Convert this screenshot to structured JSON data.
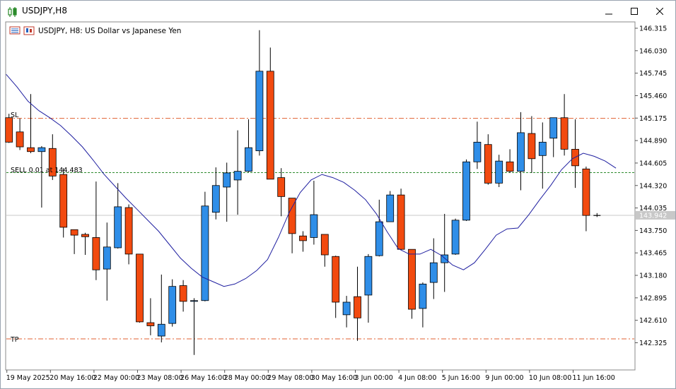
{
  "window": {
    "title": "USDJPY,H8",
    "controls": [
      "minimize",
      "maximize",
      "close"
    ]
  },
  "chart_header": "USDJPY, H8:  US Dollar vs Japanese Yen",
  "labels": {
    "sl": "SL",
    "tp": "TP",
    "order": "SELL 0.01 at 144.483",
    "current_price": "143.942"
  },
  "colors": {
    "bull": "#2f8ee8",
    "bear": "#f24a0f",
    "ma": "#1f1fa0",
    "sl_tp_line": "#e06030",
    "order_line": "#2e8b2e"
  },
  "chart_data": {
    "type": "candlestick",
    "symbol": "USDJPY",
    "timeframe": "H8",
    "ylim": [
      142.09,
      146.38
    ],
    "y_ticks": [
      "146.315",
      "146.030",
      "145.745",
      "145.460",
      "145.175",
      "144.890",
      "144.605",
      "144.320",
      "144.035",
      "143.750",
      "143.465",
      "143.180",
      "142.895",
      "142.610",
      "142.325"
    ],
    "x_labels": [
      "19 May 2025",
      "20 May 16:00",
      "22 May 00:00",
      "23 May 08:00",
      "26 May 16:00",
      "28 May 00:00",
      "29 May 08:00",
      "30 May 16:00",
      "3 Jun 00:00",
      "4 Jun 08:00",
      "5 Jun 16:00",
      "9 Jun 00:00",
      "10 Jun 08:00",
      "11 Jun 16:00"
    ],
    "x_label_index": [
      0,
      4,
      8,
      12,
      16,
      20,
      24,
      28,
      32,
      36,
      40,
      44,
      48,
      52
    ],
    "levels": {
      "sl": 145.172,
      "tp": 142.374,
      "order": 144.483,
      "current": 143.942
    },
    "candles": [
      {
        "o": 145.18,
        "h": 145.23,
        "l": 144.86,
        "c": 144.87
      },
      {
        "o": 145.0,
        "h": 145.17,
        "l": 144.77,
        "c": 144.81
      },
      {
        "o": 144.8,
        "h": 145.48,
        "l": 144.73,
        "c": 144.75
      },
      {
        "o": 144.75,
        "h": 144.82,
        "l": 144.04,
        "c": 144.8
      },
      {
        "o": 144.79,
        "h": 144.97,
        "l": 144.39,
        "c": 144.44
      },
      {
        "o": 144.46,
        "h": 144.54,
        "l": 143.66,
        "c": 143.79
      },
      {
        "o": 143.76,
        "h": 143.76,
        "l": 143.45,
        "c": 143.69
      },
      {
        "o": 143.7,
        "h": 143.72,
        "l": 143.44,
        "c": 143.67
      },
      {
        "o": 143.66,
        "h": 144.37,
        "l": 143.12,
        "c": 143.25
      },
      {
        "o": 143.26,
        "h": 143.85,
        "l": 142.86,
        "c": 143.54
      },
      {
        "o": 143.53,
        "h": 144.35,
        "l": 143.52,
        "c": 144.05
      },
      {
        "o": 144.04,
        "h": 144.08,
        "l": 143.32,
        "c": 143.45
      },
      {
        "o": 143.45,
        "h": 143.45,
        "l": 142.58,
        "c": 142.59
      },
      {
        "o": 142.58,
        "h": 142.89,
        "l": 142.42,
        "c": 142.54
      },
      {
        "o": 142.41,
        "h": 143.19,
        "l": 142.33,
        "c": 142.56
      },
      {
        "o": 142.57,
        "h": 143.13,
        "l": 142.53,
        "c": 143.04
      },
      {
        "o": 143.05,
        "h": 143.12,
        "l": 142.72,
        "c": 142.85
      },
      {
        "o": 142.85,
        "h": 142.89,
        "l": 142.17,
        "c": 142.86
      },
      {
        "o": 142.86,
        "h": 144.24,
        "l": 142.85,
        "c": 144.06
      },
      {
        "o": 143.98,
        "h": 144.55,
        "l": 143.89,
        "c": 144.32
      },
      {
        "o": 144.3,
        "h": 144.61,
        "l": 143.86,
        "c": 144.48
      },
      {
        "o": 144.39,
        "h": 145.02,
        "l": 143.95,
        "c": 144.5
      },
      {
        "o": 144.5,
        "h": 145.16,
        "l": 144.49,
        "c": 144.8
      },
      {
        "o": 144.76,
        "h": 146.29,
        "l": 144.7,
        "c": 145.77
      },
      {
        "o": 145.77,
        "h": 146.07,
        "l": 144.43,
        "c": 144.4
      },
      {
        "o": 144.42,
        "h": 144.54,
        "l": 143.93,
        "c": 144.18
      },
      {
        "o": 144.16,
        "h": 144.16,
        "l": 143.46,
        "c": 143.71
      },
      {
        "o": 143.68,
        "h": 143.74,
        "l": 143.48,
        "c": 143.62
      },
      {
        "o": 143.66,
        "h": 144.38,
        "l": 143.57,
        "c": 143.95
      },
      {
        "o": 143.7,
        "h": 143.7,
        "l": 143.29,
        "c": 143.44
      },
      {
        "o": 143.42,
        "h": 143.43,
        "l": 142.64,
        "c": 142.84
      },
      {
        "o": 142.68,
        "h": 142.92,
        "l": 142.52,
        "c": 142.84
      },
      {
        "o": 142.91,
        "h": 143.29,
        "l": 142.35,
        "c": 142.64
      },
      {
        "o": 142.93,
        "h": 143.45,
        "l": 142.58,
        "c": 143.42
      },
      {
        "o": 143.43,
        "h": 144.14,
        "l": 143.42,
        "c": 143.86
      },
      {
        "o": 143.86,
        "h": 144.25,
        "l": 143.86,
        "c": 144.2
      },
      {
        "o": 144.2,
        "h": 144.28,
        "l": 143.5,
        "c": 143.51
      },
      {
        "o": 143.51,
        "h": 143.51,
        "l": 142.63,
        "c": 142.75
      },
      {
        "o": 142.76,
        "h": 143.09,
        "l": 142.52,
        "c": 143.07
      },
      {
        "o": 143.09,
        "h": 143.65,
        "l": 142.88,
        "c": 143.34
      },
      {
        "o": 143.34,
        "h": 143.96,
        "l": 142.97,
        "c": 143.44
      },
      {
        "o": 143.45,
        "h": 143.9,
        "l": 143.44,
        "c": 143.88
      },
      {
        "o": 143.88,
        "h": 144.65,
        "l": 143.87,
        "c": 144.62
      },
      {
        "o": 144.62,
        "h": 145.13,
        "l": 144.53,
        "c": 144.87
      },
      {
        "o": 144.84,
        "h": 144.97,
        "l": 144.33,
        "c": 144.35
      },
      {
        "o": 144.35,
        "h": 144.71,
        "l": 144.3,
        "c": 144.63
      },
      {
        "o": 144.62,
        "h": 144.78,
        "l": 144.48,
        "c": 144.5
      },
      {
        "o": 144.5,
        "h": 145.25,
        "l": 144.26,
        "c": 144.99
      },
      {
        "o": 144.98,
        "h": 145.2,
        "l": 144.48,
        "c": 144.66
      },
      {
        "o": 144.7,
        "h": 145.12,
        "l": 144.28,
        "c": 144.87
      },
      {
        "o": 144.92,
        "h": 145.16,
        "l": 144.68,
        "c": 145.18
      },
      {
        "o": 145.18,
        "h": 145.48,
        "l": 144.7,
        "c": 144.78
      },
      {
        "o": 144.78,
        "h": 145.16,
        "l": 144.29,
        "c": 144.57
      },
      {
        "o": 144.53,
        "h": 144.56,
        "l": 143.74,
        "c": 143.94
      },
      {
        "o": 143.94,
        "h": 143.97,
        "l": 143.92,
        "c": 143.94
      }
    ],
    "ma": [
      145.73,
      145.57,
      145.39,
      145.27,
      145.18,
      145.08,
      144.95,
      144.81,
      144.64,
      144.46,
      144.31,
      144.16,
      144.02,
      143.88,
      143.74,
      143.57,
      143.4,
      143.27,
      143.16,
      143.1,
      143.04,
      143.07,
      143.14,
      143.24,
      143.38,
      143.66,
      143.98,
      144.23,
      144.39,
      144.46,
      144.42,
      144.36,
      144.26,
      144.14,
      143.96,
      143.73,
      143.52,
      143.45,
      143.45,
      143.51,
      143.43,
      143.31,
      143.25,
      143.34,
      143.51,
      143.69,
      143.77,
      143.78,
      143.95,
      144.14,
      144.32,
      144.52,
      144.66,
      144.73,
      144.69,
      144.63,
      144.54,
      144.46
    ]
  }
}
